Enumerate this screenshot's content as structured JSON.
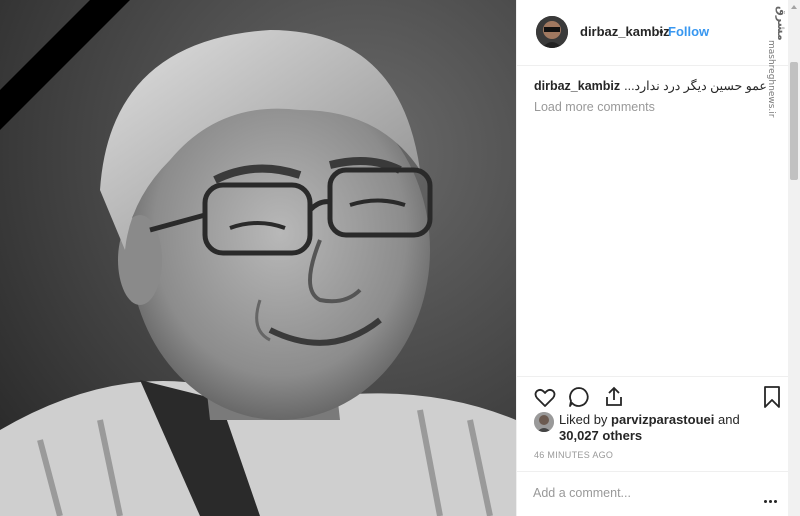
{
  "post": {
    "username": "dirbaz_kambiz",
    "follow_label": "Follow",
    "separator": "•",
    "caption_username": "dirbaz_kambiz",
    "caption_text": "عمو حسین دیگر درد ندارد...",
    "load_more": "Load more comments",
    "likes": {
      "prefix": "Liked by",
      "liker": "parvizparastouei",
      "and": "and",
      "count": "30,027 others"
    },
    "timestamp": "46 MINUTES AGO",
    "comment_placeholder": "Add a comment...",
    "more_options_icon": "ellipsis-icon"
  },
  "watermark": {
    "logo": "مشرق",
    "url": "mashreghnews.ir"
  },
  "icons": {
    "like": "heart-icon",
    "comment": "comment-icon",
    "share": "share-icon",
    "save": "bookmark-icon"
  },
  "colors": {
    "link_blue": "#3897f0",
    "text": "#262626",
    "muted": "#999999",
    "mourning_ribbon": "#000000"
  }
}
